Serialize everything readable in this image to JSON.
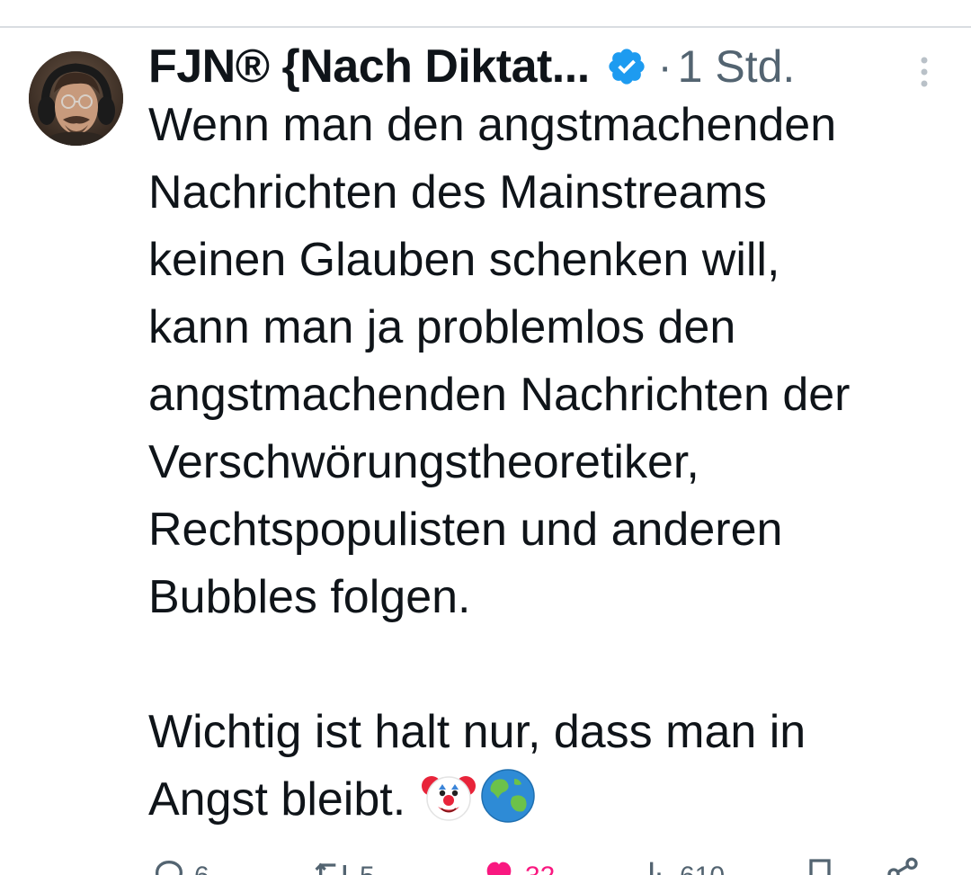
{
  "tweet": {
    "author": {
      "display_name": "FJN® {Nach Diktat...",
      "verified": true,
      "avatar_icon": "profile-photo"
    },
    "separator": "·",
    "time": "1 Std.",
    "text": "Wenn man den angstmachenden\nNachrichten des Mainstreams\nkeinen Glauben schenken will,\nkann man ja problemlos den\nangstmachenden Nachrichten der\nVerschwörungstheoretiker,\nRechtspopulisten und anderen\nBubbles folgen.\n\nWichtig ist halt nur, dass man in\nAngst bleibt.",
    "emojis": [
      "clown-face",
      "globe-asia-australia"
    ],
    "actions": {
      "reply": {
        "icon": "reply-icon",
        "count": "6"
      },
      "retweet": {
        "icon": "retweet-icon",
        "count": "5"
      },
      "like": {
        "icon": "heart-icon",
        "count": "32",
        "active": true,
        "color": "#f91880"
      },
      "views": {
        "icon": "views-icon",
        "count": "610"
      },
      "bookmark": {
        "icon": "bookmark-icon"
      },
      "share": {
        "icon": "share-icon"
      }
    }
  },
  "colors": {
    "text": "#0f1419",
    "secondary": "#536471",
    "verified_blue": "#1d9bf0",
    "like_pink": "#f91880"
  }
}
